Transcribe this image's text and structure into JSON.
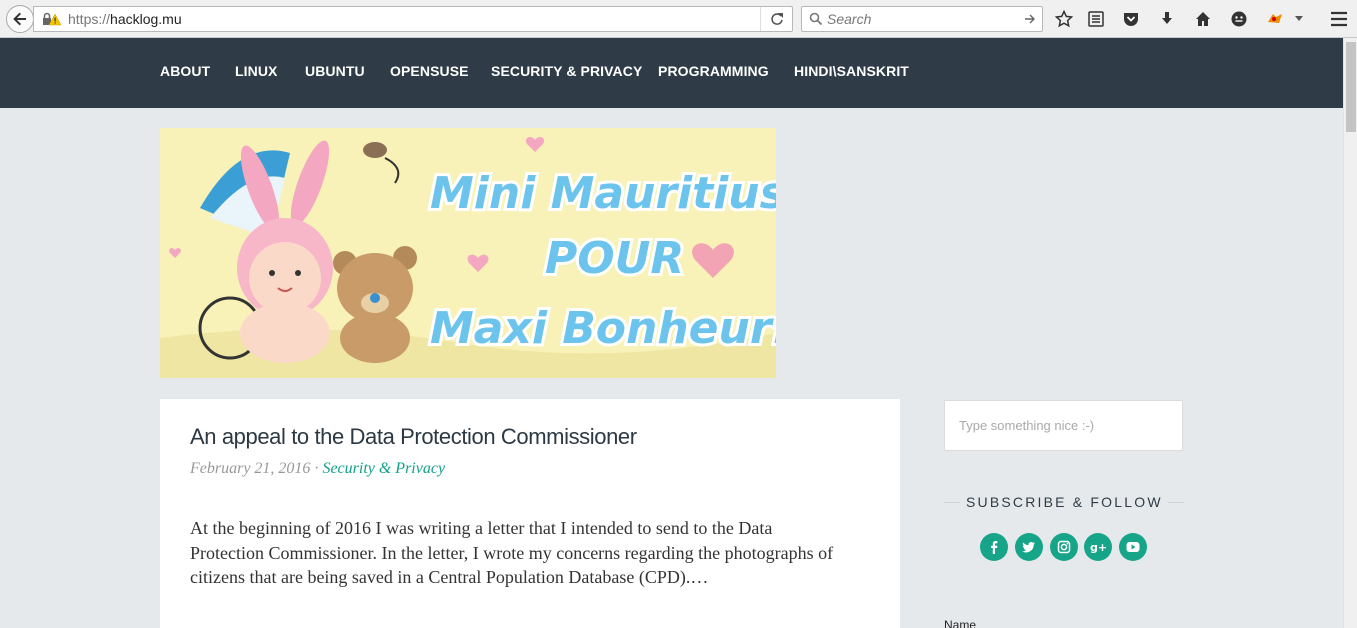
{
  "browser": {
    "url_protocol": "https://",
    "url_host": "hacklog.mu",
    "search_placeholder": "Search"
  },
  "nav": {
    "items": [
      "ABOUT",
      "LINUX",
      "UBUNTU",
      "OPENSUSE",
      "SECURITY & PRIVACY",
      "PROGRAMMING",
      "HINDI\\SANSKRIT"
    ]
  },
  "banner": {
    "line1": "Mini Mauritius",
    "line2": "POUR",
    "line3": "Maxi Bonheur!"
  },
  "post": {
    "title": "An appeal to the Data Protection Commissioner",
    "date": "February 21, 2016",
    "separator": " · ",
    "category": "Security & Privacy",
    "excerpt": "At the beginning of 2016 I was writing a letter that I intended to send to the Data Protection Commissioner. In the letter, I wrote my concerns regarding the photographs of citizens that are being saved in a Central Population Database (CPD).…"
  },
  "sidebar": {
    "search_placeholder": "Type something nice :-)",
    "subscribe_title": "SUBSCRIBE & FOLLOW",
    "social": [
      "f",
      "t",
      "ig",
      "g+",
      "yt"
    ],
    "name_label": "Name"
  },
  "colors": {
    "nav_bg": "#2f3c47",
    "accent": "#17a589",
    "page_bg": "#e6e9ec"
  }
}
